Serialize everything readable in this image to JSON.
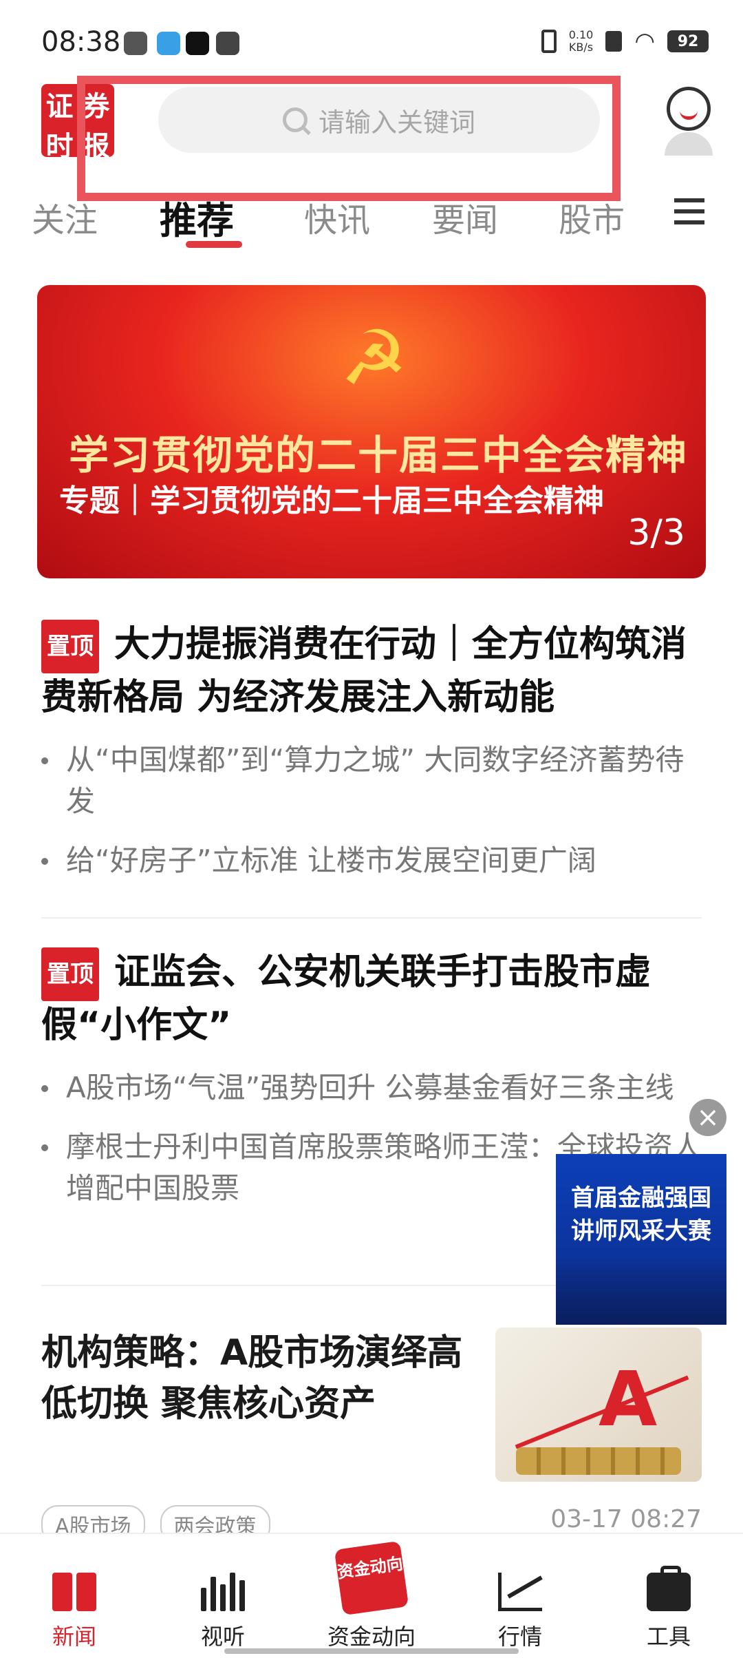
{
  "status_bar": {
    "time": "08:38",
    "network_speed_value": "0.10",
    "network_speed_unit": "KB/s",
    "battery": "92"
  },
  "header": {
    "logo_chars": [
      "证",
      "券",
      "时",
      "报"
    ],
    "search": {
      "placeholder": "请输入关键词"
    }
  },
  "tabs": {
    "items": [
      "关注",
      "推荐",
      "快讯",
      "要闻",
      "股市"
    ],
    "active": "推荐"
  },
  "banner": {
    "title_image_text": "学习贯彻党的二十届三中全会精神",
    "caption": "专题｜学习贯彻党的二十届三中全会精神",
    "page_current": "3",
    "page_total": "3",
    "page_indicator": "3/3"
  },
  "articles": [
    {
      "pin_label": "置顶",
      "title": "大力提振消费在行动｜全方位构筑消费新格局 为经济发展注入新动能",
      "subs": [
        "从“中国煤都”到“算力之城” 大同数字经济蓄势待发",
        "给“好房子”立标准 让楼市发展空间更广阔"
      ]
    },
    {
      "pin_label": "置顶",
      "title": "证监会、公安机关联手打击股市虚假“小作文”",
      "subs": [
        "A股市场“气温”强势回升 公募基金看好三条主线",
        "摩根士丹利中国首席股票策略师王滢：全球投资人增配中国股票"
      ]
    }
  ],
  "floating_ad": {
    "text": "首届金融强国讲师风采大赛",
    "close_symbol": "×"
  },
  "news_item": {
    "title": "机构策略：A股市场演绎高低切换 聚焦核心资产",
    "tags": [
      "A股市场",
      "两会政策"
    ],
    "time": "03-17 08:27"
  },
  "bottom_nav": {
    "items": [
      {
        "label": "新闻",
        "icon": "news-icon",
        "active": true
      },
      {
        "label": "视听",
        "icon": "video-icon",
        "active": false
      },
      {
        "label": "资金动向",
        "icon": "fund-flow-icon",
        "active": false,
        "icon_text": "资金动向"
      },
      {
        "label": "行情",
        "icon": "market-chart-icon",
        "active": false
      },
      {
        "label": "工具",
        "icon": "toolbox-icon",
        "active": false
      }
    ]
  },
  "colors": {
    "brand_red": "#d9222a",
    "highlight_box": "#e9555a"
  }
}
